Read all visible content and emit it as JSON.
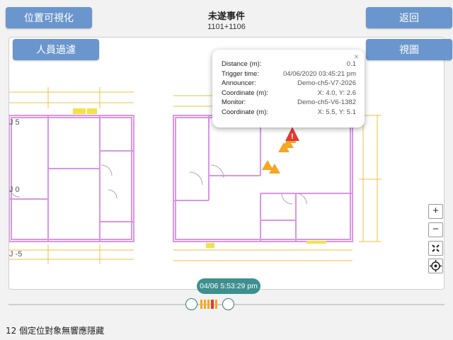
{
  "header": {
    "title": "未遂事件",
    "subtitle": "1101+1106"
  },
  "buttons": {
    "visualize": "位置可視化",
    "back": "返回",
    "filter": "人員過濾",
    "view": "視圖"
  },
  "popup": {
    "close": "×",
    "rows": [
      {
        "key": "Distance (m):",
        "value": "0.1"
      },
      {
        "key": "Trigger time:",
        "value": "04/06/2020 03:45:21 pm"
      },
      {
        "key": "Announcer:",
        "value": "Demo-ch5-V7-2026"
      },
      {
        "key": "Coordinate (m):",
        "value": "X: 4.0, Y: 2.6"
      },
      {
        "key": "Monitor:",
        "value": "Demo-ch5-V6-1382"
      },
      {
        "key": "Coordinate (m):",
        "value": "X: 5.5, Y: 5.1"
      }
    ]
  },
  "floor_labels": {
    "a": "J 5",
    "b": "J 0",
    "c": "J -5"
  },
  "zoom": {
    "in": "+",
    "out": "−"
  },
  "icons": {
    "fit": "fullscreen-icon",
    "locate": "crosshair-icon",
    "alert": "warning-icon",
    "close": "close-icon"
  },
  "timeline": {
    "current_time": "04/06 5:53:29 pm"
  },
  "status_text": "12 個定位對象無響應隱藏",
  "colors": {
    "button": "#6a96cd",
    "accent": "#3f8f8f",
    "alert_red": "#e53935",
    "alert_orange": "#f5a623",
    "wall": "#d896e6"
  }
}
